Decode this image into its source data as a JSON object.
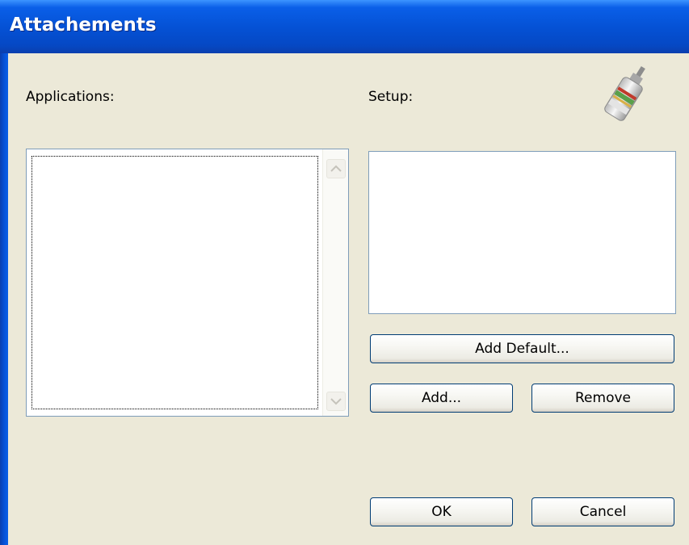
{
  "window": {
    "title": "Attachements"
  },
  "labels": {
    "applications": "Applications:",
    "setup": "Setup:"
  },
  "applications_list": {
    "items": []
  },
  "setup_list": {
    "items": []
  },
  "buttons": {
    "add_default": "Add Default...",
    "add": "Add...",
    "remove": "Remove",
    "ok": "OK",
    "cancel": "Cancel"
  },
  "colors": {
    "titlebar": "#0552d6",
    "dialog_bg": "#ece9d8",
    "button_border": "#003c74",
    "listbox_border": "#7f9db9"
  },
  "icons": {
    "header_icon": "glue-bottle-icon",
    "scroll_up": "scroll-up-arrow-icon",
    "scroll_down": "scroll-down-arrow-icon"
  }
}
